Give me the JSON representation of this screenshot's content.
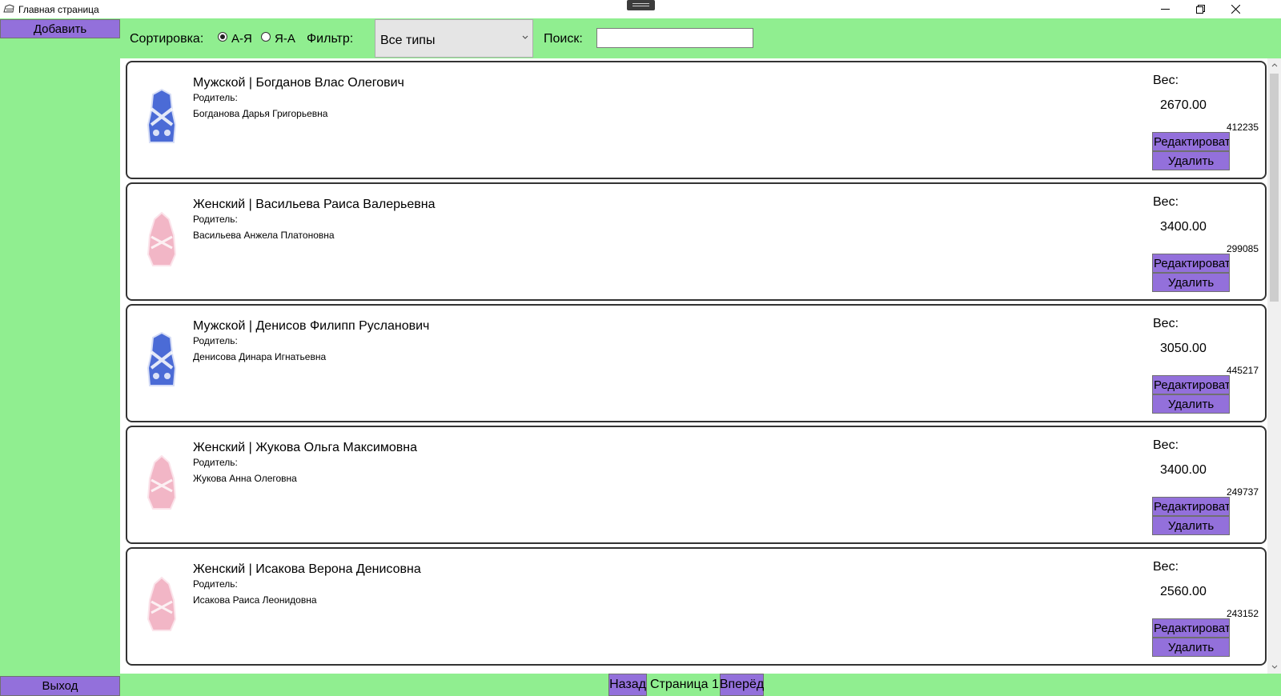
{
  "window": {
    "title": "Главная страница",
    "icons": [
      "app-icon",
      "minimize-icon",
      "restore-icon",
      "close-icon"
    ]
  },
  "sidebar": {
    "add_label": "Добавить",
    "exit_label": "Выход"
  },
  "toolbar": {
    "sort_label": "Сортировка:",
    "sort_options": [
      {
        "label": "А-Я",
        "selected": true
      },
      {
        "label": "Я-А",
        "selected": false
      }
    ],
    "filter_label": "Фильтр:",
    "filter_value": "Все типы",
    "search_label": "Поиск:",
    "search_value": ""
  },
  "labels": {
    "parent": "Родитель:",
    "weight": "Вес:",
    "edit": "Редактировать",
    "delete": "Удалить"
  },
  "items": [
    {
      "name": "Мужской | Богданов Влас Олегович",
      "parent_name": "Богданова Дарья Григорьевна",
      "weight": "2670.00",
      "code": "412235",
      "gender_color": "#4b6bd6"
    },
    {
      "name": "Женский | Васильева Раиса Валерьевна",
      "parent_name": "Васильева Анжела Платоновна",
      "weight": "3400.00",
      "code": "299085",
      "gender_color": "#f2b6c6"
    },
    {
      "name": "Мужской | Денисов Филипп Русланович",
      "parent_name": "Денисова Динара Игнатьевна",
      "weight": "3050.00",
      "code": "445217",
      "gender_color": "#4b6bd6"
    },
    {
      "name": "Женский | Жукова Ольга Максимовна",
      "parent_name": "Жукова Анна Олеговна",
      "weight": "3400.00",
      "code": "249737",
      "gender_color": "#f2b6c6"
    },
    {
      "name": "Женский | Исакова Верона Денисовна",
      "parent_name": "Исакова Раиса Леонидовна",
      "weight": "2560.00",
      "code": "243152",
      "gender_color": "#f2b6c6"
    }
  ],
  "pagination": {
    "back_label": "Назад",
    "page_label": "Страница 1",
    "next_label": "Вперёд"
  },
  "colors": {
    "panel": "#90ee90",
    "button": "#9370db"
  }
}
